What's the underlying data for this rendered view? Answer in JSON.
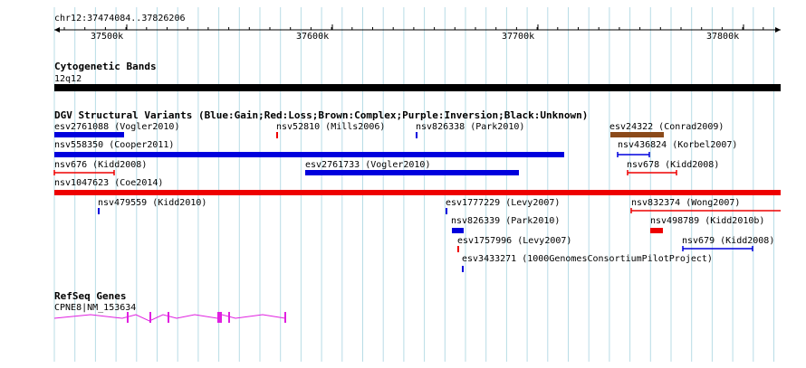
{
  "viewer": {
    "location": "chr12:37474084..37826206",
    "colors": {
      "grid": "#b8dce6",
      "gain": "#0000dd",
      "loss": "#ee0000",
      "complex": "#8b4a1a",
      "unknown": "#000000",
      "gene": "#e020e0"
    }
  },
  "ruler": {
    "ticks": [
      {
        "label": "37500k",
        "pos": 37500000
      },
      {
        "label": "37600k",
        "pos": 37600000
      },
      {
        "label": "37700k",
        "pos": 37700000
      },
      {
        "label": "37800k",
        "pos": 37800000
      }
    ]
  },
  "tracks": {
    "cytobands": {
      "title": "Cytogenetic Bands",
      "band": "12q12"
    },
    "dgv": {
      "title": "DGV Structural Variants (Blue:Gain;Red:Loss;Brown:Complex;Purple:Inversion;Black:Unknown)",
      "features": [
        {
          "label": "esv2761088 (Vogler2010)",
          "type": "gain",
          "style": "thick"
        },
        {
          "label": "nsv52810 (Mills2006)",
          "type": "loss",
          "style": "tick"
        },
        {
          "label": "nsv826338 (Park2010)",
          "type": "gain",
          "style": "tick"
        },
        {
          "label": "esv24322 (Conrad2009)",
          "type": "complex",
          "style": "thick"
        },
        {
          "label": "nsv558350 (Cooper2011)",
          "type": "gain",
          "style": "thick"
        },
        {
          "label": "nsv436824 (Korbel2007)",
          "type": "gain",
          "style": "bracket"
        },
        {
          "label": "nsv676 (Kidd2008)",
          "type": "loss",
          "style": "bracket"
        },
        {
          "label": "esv2761733 (Vogler2010)",
          "type": "gain",
          "style": "thick"
        },
        {
          "label": "nsv678 (Kidd2008)",
          "type": "loss",
          "style": "bracket"
        },
        {
          "label": "nsv1047623 (Coe2014)",
          "type": "loss",
          "style": "thick"
        },
        {
          "label": "nsv479559 (Kidd2010)",
          "type": "gain",
          "style": "tick"
        },
        {
          "label": "esv1777229 (Levy2007)",
          "type": "gain",
          "style": "tick"
        },
        {
          "label": "nsv832374 (Wong2007)",
          "type": "loss",
          "style": "open"
        },
        {
          "label": "nsv826339 (Park2010)",
          "type": "gain",
          "style": "thick"
        },
        {
          "label": "nsv498789 (Kidd2010b)",
          "type": "loss",
          "style": "thick"
        },
        {
          "label": "esv1757996 (Levy2007)",
          "type": "loss",
          "style": "tick"
        },
        {
          "label": "nsv679 (Kidd2008)",
          "type": "gain",
          "style": "bracket"
        },
        {
          "label": "esv3433271 (1000GenomesConsortiumPilotProject)",
          "type": "gain",
          "style": "tick"
        }
      ]
    },
    "refseq": {
      "title": "RefSeq Genes",
      "genes": [
        {
          "label": "CPNE8|NM_153634",
          "strand": "-"
        }
      ]
    }
  }
}
